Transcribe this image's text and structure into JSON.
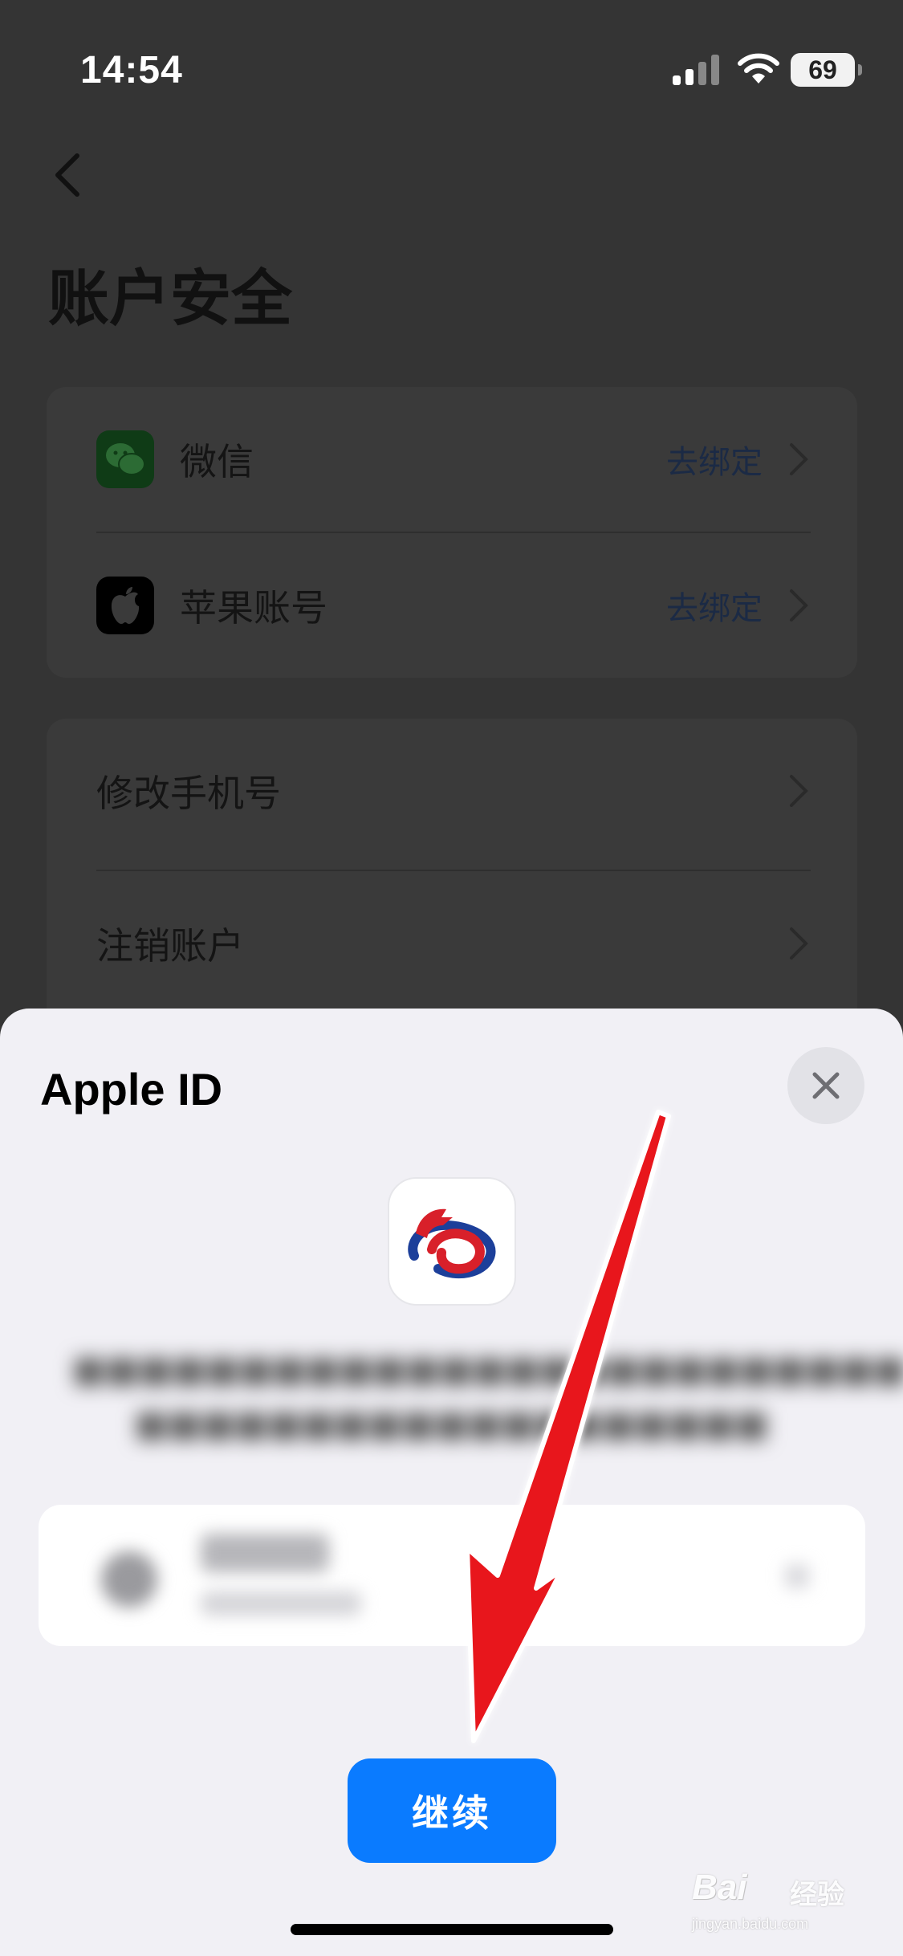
{
  "status_bar": {
    "time": "14:54",
    "battery": "69",
    "icons": [
      "signal-icon",
      "wifi-icon",
      "battery-icon"
    ]
  },
  "page": {
    "back_icon": "chevron-left-icon",
    "title": "账户安全",
    "binding_items": [
      {
        "label": "微信",
        "action": "去绑定",
        "icon": "wechat-icon"
      },
      {
        "label": "苹果账号",
        "action": "去绑定",
        "icon": "apple-icon"
      }
    ],
    "settings_items": [
      {
        "label": "修改手机号"
      },
      {
        "label": "注销账户"
      }
    ]
  },
  "sheet": {
    "title": "Apple ID",
    "close_icon": "close-icon",
    "app_icon": "app-logo-icon",
    "continue_label": "继续"
  },
  "watermark": {
    "logo": "Bai",
    "text": "经验",
    "url": "jingyan.baidu.com"
  },
  "colors": {
    "accent": "#0a7bff",
    "annotation_arrow": "#e8141b",
    "overlay_background": "#343434",
    "sheet_background": "#f1f0f5"
  }
}
